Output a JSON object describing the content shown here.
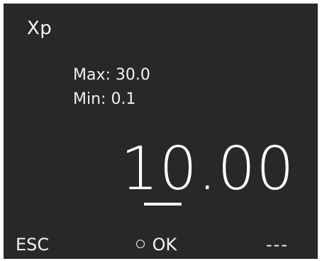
{
  "screen": {
    "title": "Xp",
    "max_label": "Max: 30.0",
    "min_label": "Min: 0.1",
    "value": {
      "full": "10.00",
      "digit_1": "1",
      "digit_2": "0",
      "decimal": ".",
      "digit_3": "0",
      "digit_4": "0"
    }
  },
  "softkeys": {
    "left_label": "ESC",
    "center_label": "OK",
    "center_icon": "ring-icon",
    "right_label": "---"
  },
  "colors": {
    "background": "#2a2827",
    "text": "#f2f2f2"
  }
}
